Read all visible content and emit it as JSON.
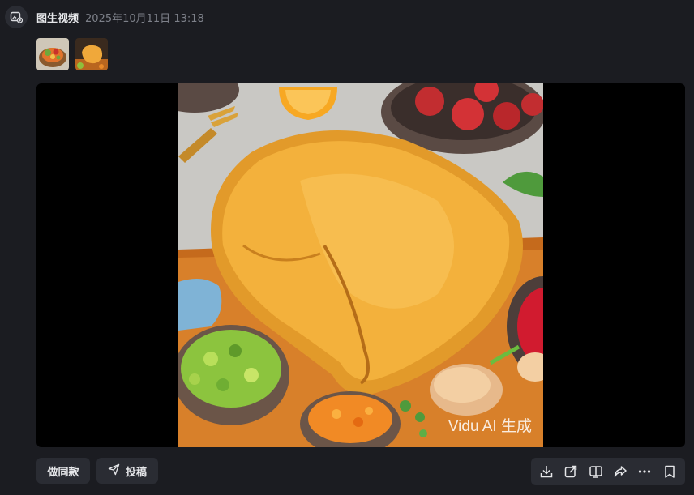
{
  "header": {
    "title": "图生视频",
    "timestamp": "2025年10月11日 13:18",
    "icon": "image-to-video-icon"
  },
  "thumbnails": [
    {
      "icon": "reference-image-salad"
    },
    {
      "icon": "reference-image-fried-chicken"
    }
  ],
  "video": {
    "watermark": "Vidu AI 生成"
  },
  "actions": {
    "same_style_label": "做同款",
    "submit_label": "投稿"
  },
  "toolbar": {
    "icons": [
      "download-icon",
      "export-icon",
      "subtitle-icon",
      "share-icon",
      "more-icon",
      "bookmark-icon"
    ]
  },
  "colors": {
    "background": "#1b1c21",
    "surface": "#2a2c33",
    "text_primary": "#e6e7ea",
    "text_secondary": "#7d8089"
  }
}
